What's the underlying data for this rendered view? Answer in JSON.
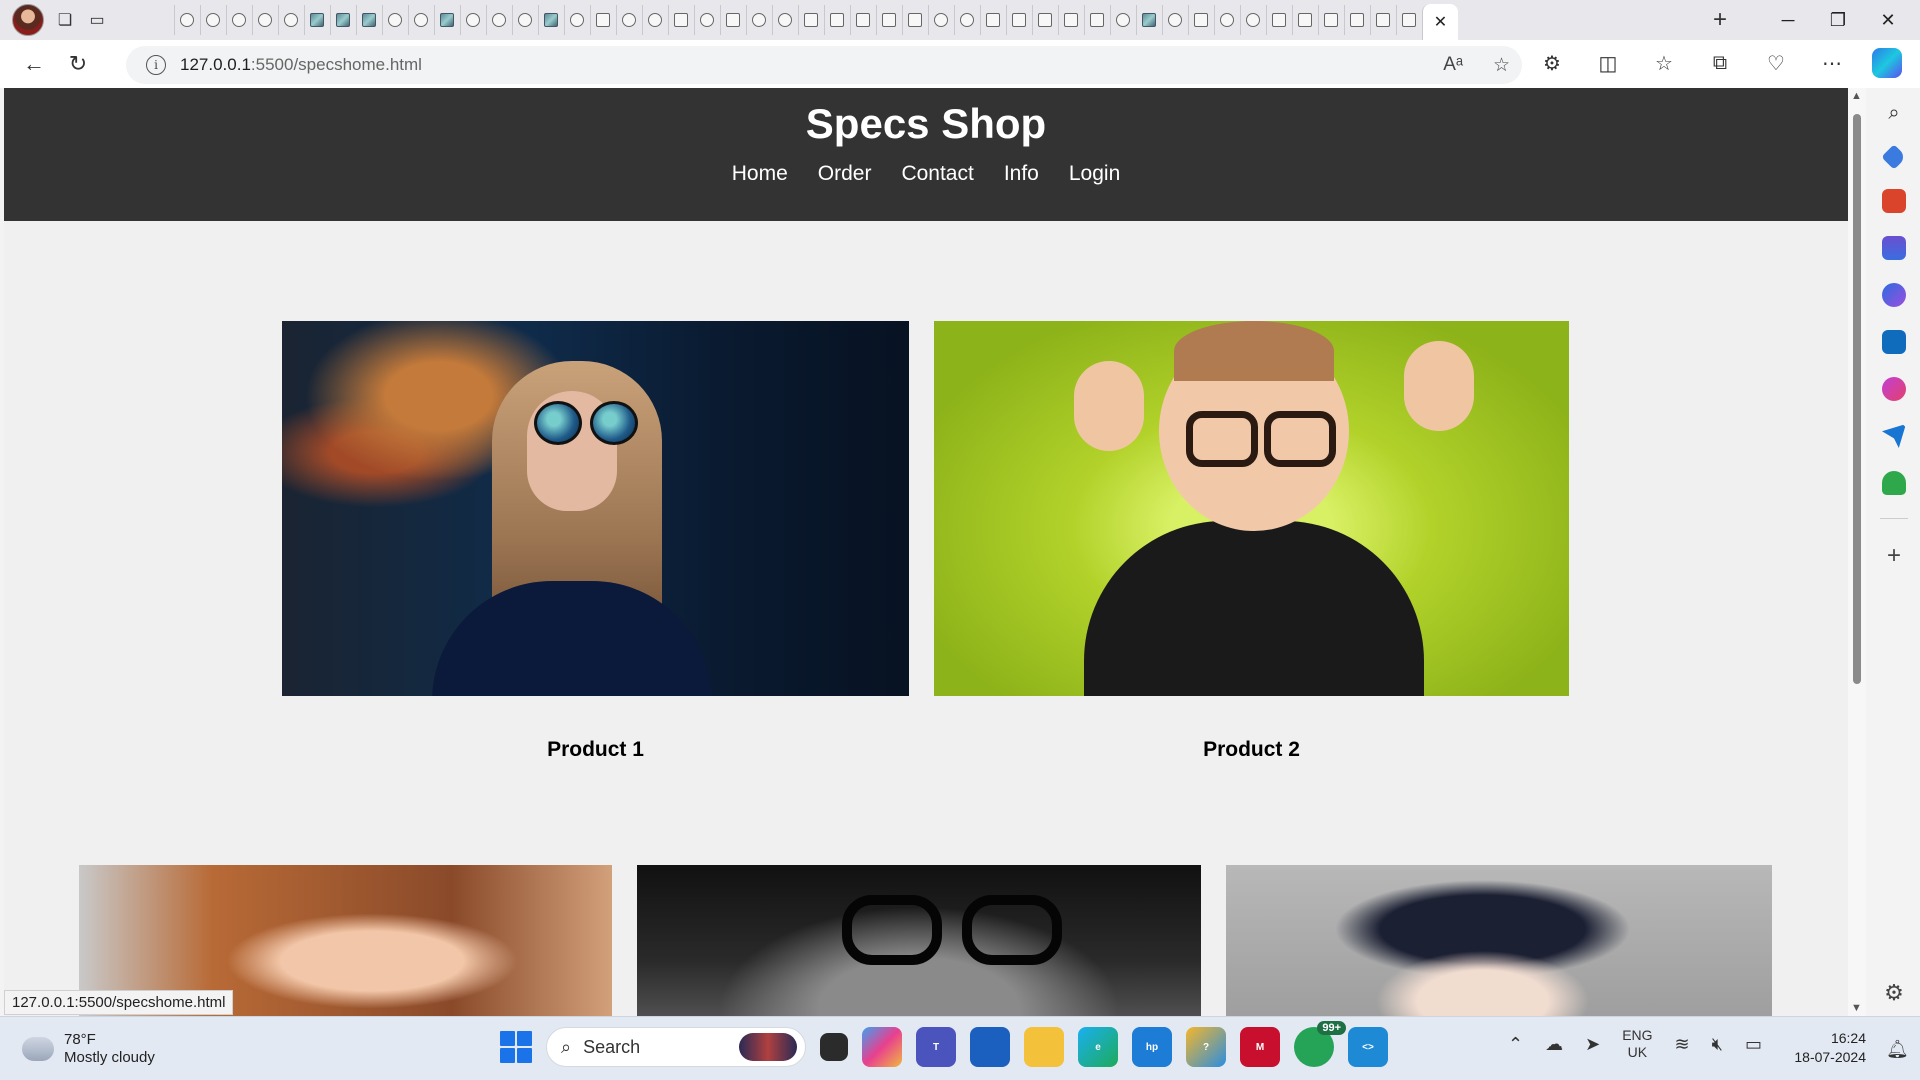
{
  "browser": {
    "window_controls": {
      "minimize": "─",
      "restore": "❐",
      "close": "✕"
    },
    "new_tab_label": "+",
    "active_tab_close": "✕",
    "address": {
      "host": "127.0.0.1",
      "path": ":5500/specshome.html"
    },
    "status_bar_url": "127.0.0.1:5500/specshome.html"
  },
  "site": {
    "title": "Specs Shop",
    "nav": [
      "Home",
      "Order",
      "Contact",
      "Info",
      "Login"
    ]
  },
  "products": [
    {
      "caption": "Product 1"
    },
    {
      "caption": "Product 2"
    }
  ],
  "taskbar": {
    "weather": {
      "temp": "78°F",
      "condition": "Mostly cloudy"
    },
    "search_label": "Search",
    "whatsapp_badge": "99+",
    "lang": {
      "line1": "ENG",
      "line2": "UK"
    },
    "clock": {
      "time": "16:24",
      "date": "18-07-2024"
    }
  },
  "colors": {
    "site_header_bg": "#333333",
    "page_bg": "#f0f0f0",
    "taskbar_bg": "#e3e9f3",
    "accent": "#1a73e8"
  }
}
